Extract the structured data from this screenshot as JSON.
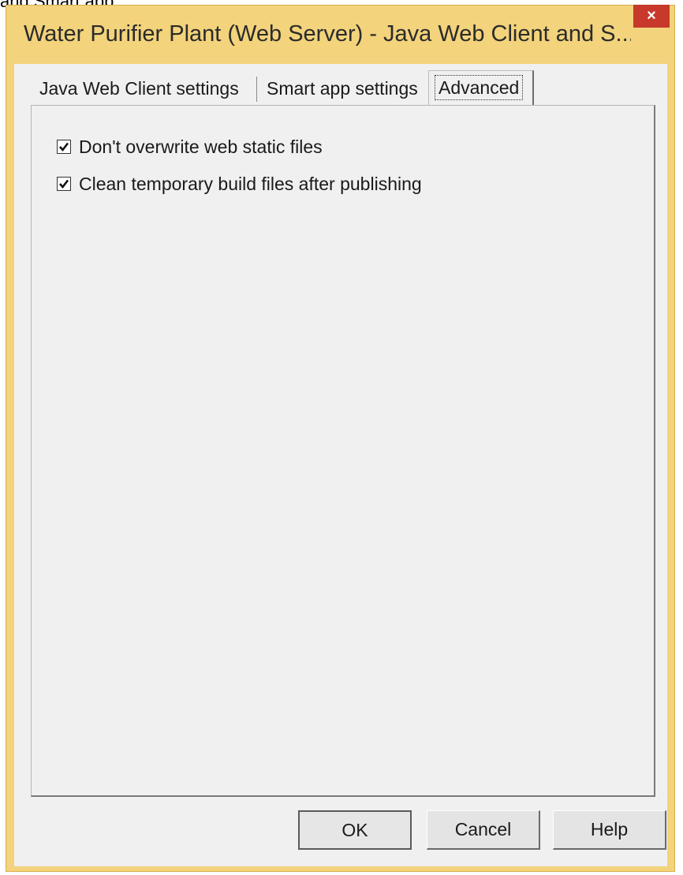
{
  "caption_fragment": "and Smart app.",
  "window": {
    "title": "Water Purifier Plant (Web Server) - Java Web Client and S...",
    "close_glyph": "×",
    "accent_color": "#f3d37b",
    "close_color": "#c7392b"
  },
  "tabs": [
    {
      "label": "Java Web Client settings",
      "active": false
    },
    {
      "label": "Smart app settings",
      "active": false
    },
    {
      "label": "Advanced",
      "active": true
    }
  ],
  "advanced": {
    "options": [
      {
        "label": "Don't overwrite web static files",
        "checked": true
      },
      {
        "label": "Clean temporary build files after publishing",
        "checked": true
      }
    ]
  },
  "buttons": {
    "ok": "OK",
    "cancel": "Cancel",
    "help": "Help"
  }
}
